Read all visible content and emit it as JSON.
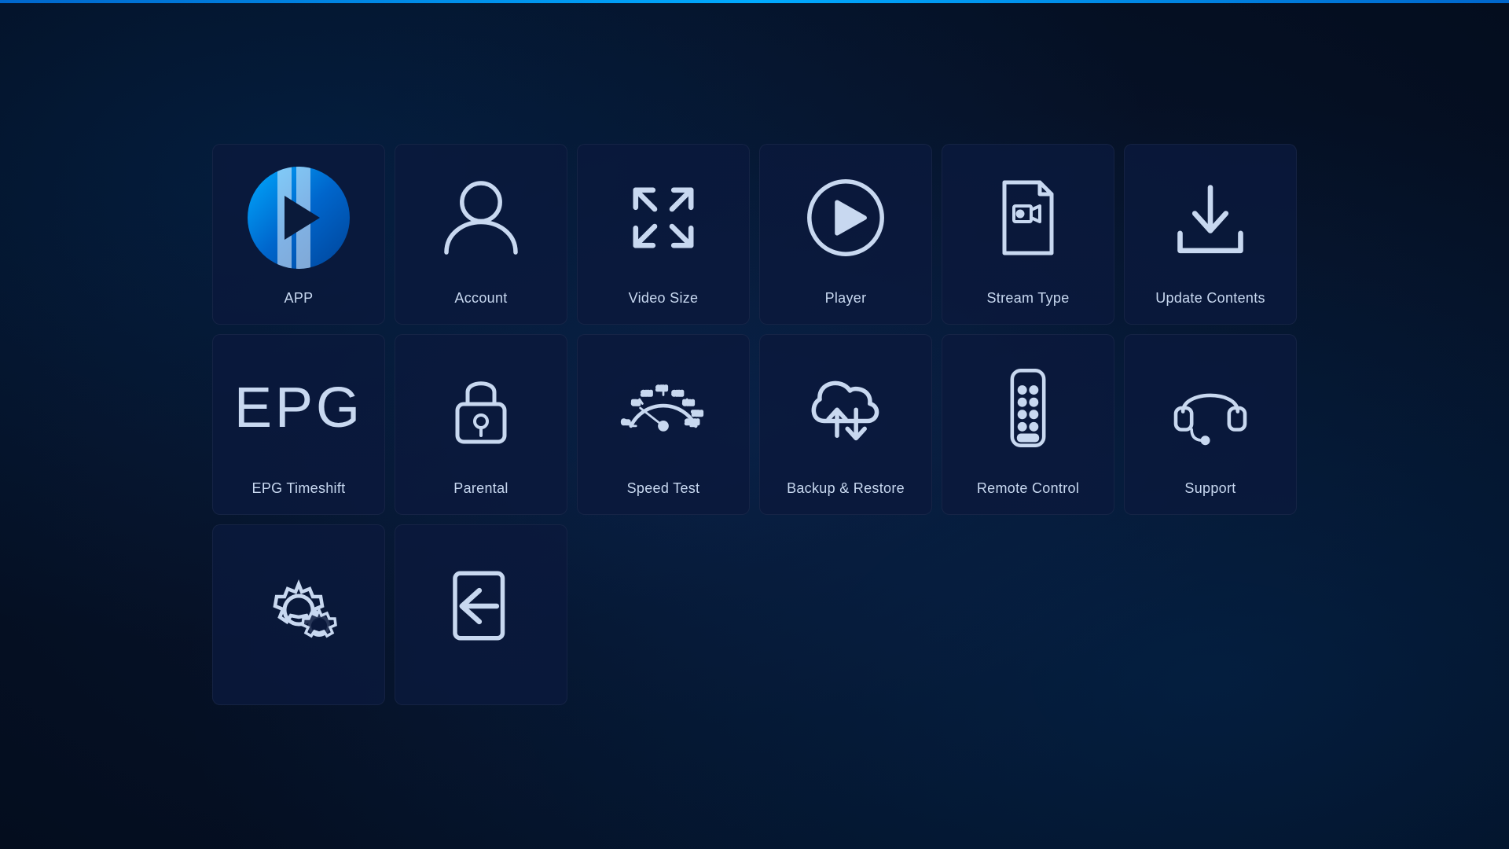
{
  "tiles": [
    {
      "id": "app",
      "label": "APP",
      "col": 1,
      "row": 1
    },
    {
      "id": "account",
      "label": "Account",
      "col": 2,
      "row": 1
    },
    {
      "id": "video-size",
      "label": "Video Size",
      "col": 3,
      "row": 1
    },
    {
      "id": "player",
      "label": "Player",
      "col": 4,
      "row": 1
    },
    {
      "id": "stream-type",
      "label": "Stream Type",
      "col": 5,
      "row": 1
    },
    {
      "id": "update-contents",
      "label": "Update Contents",
      "col": 6,
      "row": 1
    },
    {
      "id": "epg-timeshift",
      "label": "EPG Timeshift",
      "col": 1,
      "row": 2
    },
    {
      "id": "parental",
      "label": "Parental",
      "col": 2,
      "row": 2
    },
    {
      "id": "speed-test",
      "label": "Speed Test",
      "col": 3,
      "row": 2
    },
    {
      "id": "backup-restore",
      "label": "Backup & Restore",
      "col": 4,
      "row": 2
    },
    {
      "id": "remote-control",
      "label": "Remote Control",
      "col": 5,
      "row": 2
    },
    {
      "id": "support",
      "label": "Support",
      "col": 6,
      "row": 2
    },
    {
      "id": "settings",
      "label": "",
      "col": 1,
      "row": 3
    },
    {
      "id": "logout",
      "label": "",
      "col": 2,
      "row": 3
    }
  ]
}
